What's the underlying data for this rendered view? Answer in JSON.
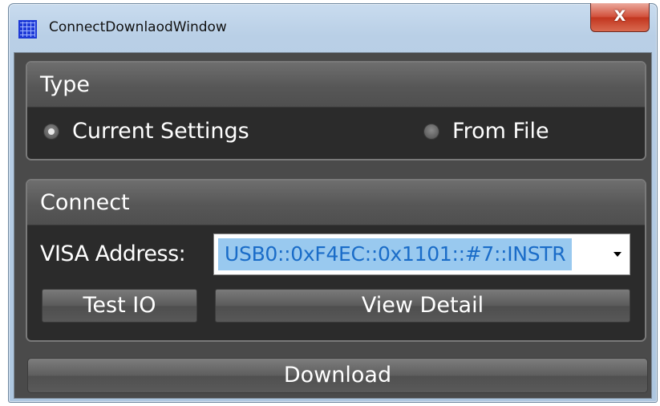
{
  "window": {
    "title": "ConnectDownlaodWindow",
    "app_icon": "grid-app-icon",
    "close_label": "X"
  },
  "type_group": {
    "header": "Type",
    "options": [
      {
        "label": "Current Settings",
        "checked": true
      },
      {
        "label": "From File",
        "checked": false
      }
    ]
  },
  "connect_group": {
    "header": "Connect",
    "visa_label": "VISA Address:",
    "visa_value": "USB0::0xF4EC::0x1101::#7::INSTR",
    "test_io_label": "Test IO",
    "view_detail_label": "View Detail"
  },
  "download_label": "Download",
  "colors": {
    "client_background": "#4a4a4a",
    "group_body": "#2b2b2b",
    "selection_highlight": "#99c9ef",
    "selection_text": "#1a6cc8",
    "close_button": "#c2361f"
  }
}
